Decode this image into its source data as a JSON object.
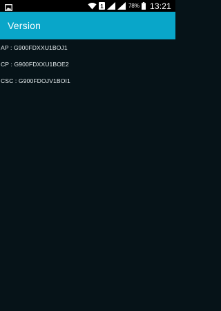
{
  "status_bar": {
    "icons": [
      "gallery-notification-icon",
      "wifi-icon",
      "sim-1-icon",
      "signal-icon",
      "signal-icon",
      "battery-icon"
    ],
    "sim_label": "1",
    "battery_percent": "78%",
    "time": "13:21",
    "colors": {
      "background": "#000000",
      "foreground": "#ffffff"
    }
  },
  "action_bar": {
    "title": "Version",
    "background": "#09a6c9"
  },
  "info": {
    "items": [
      {
        "label": "AP : G900FDXXU1BOJ1"
      },
      {
        "label": "CP : G900FDXXU1BOE2"
      },
      {
        "label": "CSC : G900FDOJV1BOI1"
      }
    ]
  },
  "colors": {
    "page_background": "#061318",
    "text": "#e7eef0"
  }
}
